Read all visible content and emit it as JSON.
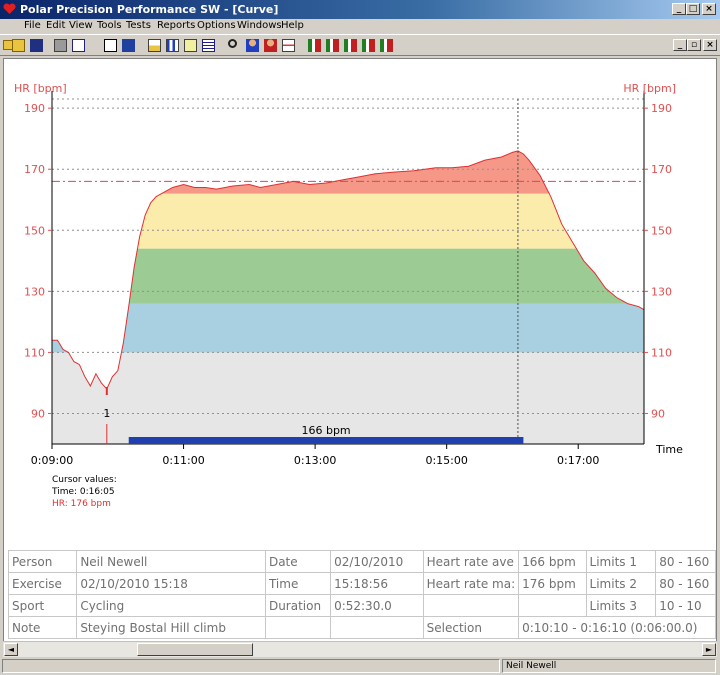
{
  "window": {
    "title": "Polar Precision Performance SW - [Curve]",
    "min_glyph": "_",
    "max_glyph": "□",
    "close_glyph": "×",
    "restore_glyph": "▫"
  },
  "menu": [
    "File",
    "Edit",
    "View",
    "Tools",
    "Tests",
    "Reports",
    "Options",
    "Windows",
    "Help"
  ],
  "toolbar_icons": [
    "open-icon",
    "save-icon",
    "print-icon",
    "copy-icon",
    "calendar-icon",
    "book-icon",
    "curve-icon",
    "bar-chart-icon",
    "calculator-icon",
    "table-icon",
    "zoom-icon",
    "person-icon",
    "exercise-icon",
    "graph-icon",
    "analysis-icon-1",
    "analysis-icon-2",
    "analysis-icon-3",
    "analysis-icon-4",
    "analysis-icon-5"
  ],
  "chart": {
    "y_label_left": "HR [bpm]",
    "y_label_right": "HR [bpm]",
    "x_label": "Time",
    "marker_label": "1",
    "avg_label": "166 bpm"
  },
  "chart_data": {
    "type": "line",
    "ylabel": "HR [bpm]",
    "xlabel": "Time",
    "ylim": [
      80,
      193
    ],
    "xlim_seconds": [
      540,
      1080
    ],
    "y_ticks": [
      90,
      110,
      130,
      150,
      170,
      190
    ],
    "x_ticks": [
      "0:09:00",
      "0:11:00",
      "0:13:00",
      "0:15:00",
      "0:17:00"
    ],
    "limit_zones": [
      {
        "from": 110,
        "to": 126,
        "color": "#a8d0e0"
      },
      {
        "from": 126,
        "to": 144,
        "color": "#9ccc94"
      },
      {
        "from": 144,
        "to": 162,
        "color": "#fcecac"
      },
      {
        "from": 162,
        "to": 180,
        "color": "#f69888"
      },
      {
        "from": 180,
        "to": 190,
        "color": "#dde4ee"
      }
    ],
    "average_hr": 166,
    "cursor_time": "0:16:05",
    "cursor_hr": 176,
    "selection_bar_start": "0:10:10",
    "selection_bar_end": "0:16:10",
    "series": [
      {
        "color": "#e03030",
        "points": [
          [
            "0:09:00",
            114
          ],
          [
            "0:09:05",
            114
          ],
          [
            "0:09:10",
            111
          ],
          [
            "0:09:15",
            110
          ],
          [
            "0:09:20",
            107
          ],
          [
            "0:09:25",
            106
          ],
          [
            "0:09:30",
            102
          ],
          [
            "0:09:35",
            99
          ],
          [
            "0:09:40",
            103
          ],
          [
            "0:09:45",
            100
          ],
          [
            "0:09:50",
            98
          ],
          [
            "0:09:55",
            102
          ],
          [
            "0:10:00",
            104
          ],
          [
            "0:10:05",
            113
          ],
          [
            "0:10:10",
            125
          ],
          [
            "0:10:15",
            138
          ],
          [
            "0:10:20",
            148
          ],
          [
            "0:10:25",
            155
          ],
          [
            "0:10:30",
            159
          ],
          [
            "0:10:35",
            161
          ],
          [
            "0:10:40",
            162
          ],
          [
            "0:10:50",
            164
          ],
          [
            "0:11:00",
            165
          ],
          [
            "0:11:10",
            164
          ],
          [
            "0:11:20",
            164
          ],
          [
            "0:11:30",
            163.5
          ],
          [
            "0:11:45",
            164.5
          ],
          [
            "0:12:00",
            165
          ],
          [
            "0:12:10",
            164
          ],
          [
            "0:12:25",
            165
          ],
          [
            "0:12:40",
            166
          ],
          [
            "0:12:55",
            165
          ],
          [
            "0:13:10",
            165.5
          ],
          [
            "0:13:25",
            166.5
          ],
          [
            "0:13:40",
            167.5
          ],
          [
            "0:13:55",
            168.5
          ],
          [
            "0:14:10",
            169
          ],
          [
            "0:14:30",
            169.5
          ],
          [
            "0:14:50",
            170.5
          ],
          [
            "0:15:05",
            170.5
          ],
          [
            "0:15:20",
            171
          ],
          [
            "0:15:35",
            173
          ],
          [
            "0:15:50",
            174
          ],
          [
            "0:16:00",
            175.5
          ],
          [
            "0:16:05",
            176
          ],
          [
            "0:16:10",
            175
          ],
          [
            "0:16:15",
            173
          ],
          [
            "0:16:25",
            168
          ],
          [
            "0:16:35",
            161
          ],
          [
            "0:16:45",
            152
          ],
          [
            "0:16:55",
            146
          ],
          [
            "0:17:05",
            140
          ],
          [
            "0:17:15",
            136
          ],
          [
            "0:17:25",
            131
          ],
          [
            "0:17:35",
            128
          ],
          [
            "0:17:45",
            126
          ],
          [
            "0:17:55",
            125
          ],
          [
            "0:18:00",
            124
          ]
        ]
      }
    ]
  },
  "cursor_values": {
    "title": "Cursor values:",
    "time": "Time: 0:16:05",
    "hr": "HR: 176 bpm"
  },
  "info_table": [
    [
      "Person",
      "Neil Newell",
      "Date",
      "02/10/2010",
      "Heart rate ave",
      "166 bpm",
      "Limits 1",
      "80 - 160"
    ],
    [
      "Exercise",
      "02/10/2010 15:18",
      "Time",
      "15:18:56",
      "Heart rate ma:",
      "176 bpm",
      "Limits 2",
      "80 - 160"
    ],
    [
      "Sport",
      "Cycling",
      "Duration",
      "0:52:30.0",
      "",
      "",
      "Limits 3",
      "10 - 10"
    ],
    [
      "Note",
      "Steying Bostal Hill climb",
      "",
      "",
      "Selection",
      "0:10:10 - 0:16:10 (0:06:00.0)",
      "",
      ""
    ]
  ],
  "scroll": {
    "left_glyph": "◄",
    "right_glyph": "►"
  },
  "status": {
    "user": "Neil Newell"
  }
}
